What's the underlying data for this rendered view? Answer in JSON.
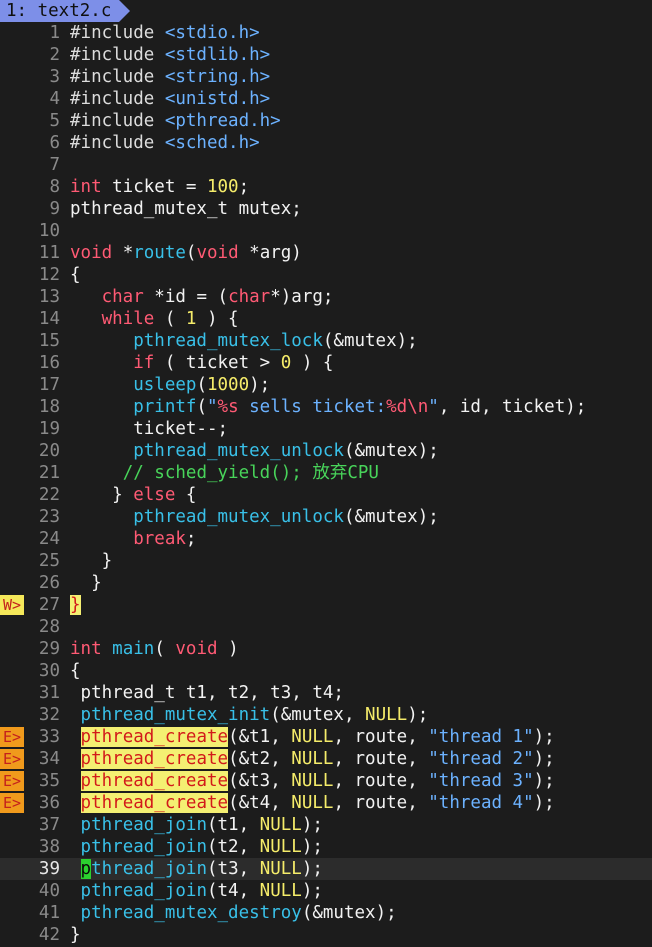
{
  "tab": {
    "label": "1: text2.c"
  },
  "colors": {
    "tab_bg": "#7d8fe8",
    "background": "#1c1c1c",
    "error_sign": "#f09a1c",
    "warning_sign": "#f5e85a",
    "cursor": "#2bd12e"
  },
  "signs": {
    "error": "E>",
    "warning": "W>"
  },
  "cursor": {
    "line": 39
  },
  "lines": [
    {
      "n": "1",
      "t": [
        [
          "#include ",
          "pp"
        ],
        [
          "<stdio.h>",
          "inc"
        ]
      ]
    },
    {
      "n": "2",
      "t": [
        [
          "#include ",
          "pp"
        ],
        [
          "<stdlib.h>",
          "inc"
        ]
      ]
    },
    {
      "n": "3",
      "t": [
        [
          "#include ",
          "pp"
        ],
        [
          "<string.h>",
          "inc"
        ]
      ]
    },
    {
      "n": "4",
      "t": [
        [
          "#include ",
          "pp"
        ],
        [
          "<unistd.h>",
          "inc"
        ]
      ]
    },
    {
      "n": "5",
      "t": [
        [
          "#include ",
          "pp"
        ],
        [
          "<pthread.h>",
          "inc"
        ]
      ]
    },
    {
      "n": "6",
      "t": [
        [
          "#include ",
          "pp"
        ],
        [
          "<sched.h>",
          "inc"
        ]
      ]
    },
    {
      "n": "7",
      "t": []
    },
    {
      "n": "8",
      "t": [
        [
          "int",
          "ty"
        ],
        [
          " ticket = ",
          ""
        ],
        [
          "100",
          "num"
        ],
        [
          ";",
          ""
        ]
      ]
    },
    {
      "n": "9",
      "t": [
        [
          "pthread_mutex_t mutex;",
          ""
        ]
      ]
    },
    {
      "n": "10",
      "t": []
    },
    {
      "n": "11",
      "t": [
        [
          "void",
          "ty"
        ],
        [
          " *",
          ""
        ],
        [
          "route",
          "fn"
        ],
        [
          "(",
          ""
        ],
        [
          "void",
          "ty"
        ],
        [
          " *arg)",
          ""
        ]
      ]
    },
    {
      "n": "12",
      "t": [
        [
          "{",
          ""
        ]
      ]
    },
    {
      "n": "13",
      "t": [
        [
          "   ",
          ""
        ],
        [
          "char",
          "ty"
        ],
        [
          " *id = (",
          ""
        ],
        [
          "char",
          "ty"
        ],
        [
          "*)arg;",
          ""
        ]
      ]
    },
    {
      "n": "14",
      "t": [
        [
          "   ",
          ""
        ],
        [
          "while",
          "kw"
        ],
        [
          " ( ",
          ""
        ],
        [
          "1",
          "num"
        ],
        [
          " ) {",
          ""
        ]
      ]
    },
    {
      "n": "15",
      "t": [
        [
          "      ",
          ""
        ],
        [
          "pthread_mutex_lock",
          "fn"
        ],
        [
          "(&mutex);",
          ""
        ]
      ]
    },
    {
      "n": "16",
      "t": [
        [
          "      ",
          ""
        ],
        [
          "if",
          "kw"
        ],
        [
          " ( ticket > ",
          ""
        ],
        [
          "0",
          "num"
        ],
        [
          " ) {",
          ""
        ]
      ]
    },
    {
      "n": "17",
      "t": [
        [
          "      ",
          ""
        ],
        [
          "usleep",
          "fn"
        ],
        [
          "(",
          ""
        ],
        [
          "1000",
          "num"
        ],
        [
          ");",
          ""
        ]
      ]
    },
    {
      "n": "18",
      "t": [
        [
          "      ",
          ""
        ],
        [
          "printf",
          "fn"
        ],
        [
          "(",
          ""
        ],
        [
          "\"",
          "str"
        ],
        [
          "%s",
          "esc"
        ],
        [
          " sells ticket:",
          "str"
        ],
        [
          "%d\\n",
          "esc"
        ],
        [
          "\"",
          "str"
        ],
        [
          ", id, ticket);",
          ""
        ]
      ]
    },
    {
      "n": "19",
      "t": [
        [
          "      ticket--;",
          ""
        ]
      ]
    },
    {
      "n": "20",
      "t": [
        [
          "      ",
          ""
        ],
        [
          "pthread_mutex_unlock",
          "fn"
        ],
        [
          "(&mutex);",
          ""
        ]
      ]
    },
    {
      "n": "21",
      "t": [
        [
          "     ",
          ""
        ],
        [
          "// sched_yield(); 放弃CPU",
          "cm"
        ]
      ]
    },
    {
      "n": "22",
      "t": [
        [
          "    } ",
          ""
        ],
        [
          "else",
          "kw"
        ],
        [
          " {",
          ""
        ]
      ]
    },
    {
      "n": "23",
      "t": [
        [
          "      ",
          ""
        ],
        [
          "pthread_mutex_unlock",
          "fn"
        ],
        [
          "(&mutex);",
          ""
        ]
      ]
    },
    {
      "n": "24",
      "t": [
        [
          "      ",
          ""
        ],
        [
          "break",
          "kw"
        ],
        [
          ";",
          ""
        ]
      ]
    },
    {
      "n": "25",
      "t": [
        [
          "   }",
          ""
        ]
      ]
    },
    {
      "n": "26",
      "t": [
        [
          "  }",
          ""
        ]
      ]
    },
    {
      "n": "27",
      "sign": "warn",
      "t": [
        [
          "}",
          "warnhl"
        ]
      ]
    },
    {
      "n": "28",
      "t": []
    },
    {
      "n": "29",
      "t": [
        [
          "int",
          "ty"
        ],
        [
          " ",
          ""
        ],
        [
          "main",
          "fn"
        ],
        [
          "( ",
          ""
        ],
        [
          "void",
          "ty"
        ],
        [
          " )",
          ""
        ]
      ]
    },
    {
      "n": "30",
      "t": [
        [
          "{",
          ""
        ]
      ]
    },
    {
      "n": "31",
      "t": [
        [
          " pthread_t t1, t2, t3, t4;",
          ""
        ]
      ]
    },
    {
      "n": "32",
      "t": [
        [
          " ",
          ""
        ],
        [
          "pthread_mutex_init",
          "fn"
        ],
        [
          "(&mutex, ",
          ""
        ],
        [
          "NULL",
          "nul"
        ],
        [
          ");",
          ""
        ]
      ]
    },
    {
      "n": "33",
      "sign": "err",
      "t": [
        [
          " ",
          ""
        ],
        [
          "pthread_create",
          "errhl"
        ],
        [
          "(&t1, ",
          ""
        ],
        [
          "NULL",
          "nul"
        ],
        [
          ", route, ",
          ""
        ],
        [
          "\"thread 1\"",
          "str"
        ],
        [
          ");",
          ""
        ]
      ]
    },
    {
      "n": "34",
      "sign": "err",
      "t": [
        [
          " ",
          ""
        ],
        [
          "pthread_create",
          "errhl"
        ],
        [
          "(&t2, ",
          ""
        ],
        [
          "NULL",
          "nul"
        ],
        [
          ", route, ",
          ""
        ],
        [
          "\"thread 2\"",
          "str"
        ],
        [
          ");",
          ""
        ]
      ]
    },
    {
      "n": "35",
      "sign": "err",
      "t": [
        [
          " ",
          ""
        ],
        [
          "pthread_create",
          "errhl"
        ],
        [
          "(&t3, ",
          ""
        ],
        [
          "NULL",
          "nul"
        ],
        [
          ", route, ",
          ""
        ],
        [
          "\"thread 3\"",
          "str"
        ],
        [
          ");",
          ""
        ]
      ]
    },
    {
      "n": "36",
      "sign": "err",
      "t": [
        [
          " ",
          ""
        ],
        [
          "pthread_create",
          "errhl"
        ],
        [
          "(&t4, ",
          ""
        ],
        [
          "NULL",
          "nul"
        ],
        [
          ", route, ",
          ""
        ],
        [
          "\"thread 4\"",
          "str"
        ],
        [
          ");",
          ""
        ]
      ]
    },
    {
      "n": "37",
      "t": [
        [
          " ",
          ""
        ],
        [
          "pthread_join",
          "fn"
        ],
        [
          "(t1, ",
          ""
        ],
        [
          "NULL",
          "nul"
        ],
        [
          ");",
          ""
        ]
      ]
    },
    {
      "n": "38",
      "t": [
        [
          " ",
          ""
        ],
        [
          "pthread_join",
          "fn"
        ],
        [
          "(t2, ",
          ""
        ],
        [
          "NULL",
          "nul"
        ],
        [
          ");",
          ""
        ]
      ]
    },
    {
      "n": "39",
      "t": [
        [
          " ",
          ""
        ],
        [
          "p",
          "cur"
        ],
        [
          "thread_join",
          "fn"
        ],
        [
          "(t3, ",
          ""
        ],
        [
          "NULL",
          "nul"
        ],
        [
          ");",
          ""
        ]
      ]
    },
    {
      "n": "40",
      "t": [
        [
          " ",
          ""
        ],
        [
          "pthread_join",
          "fn"
        ],
        [
          "(t4, ",
          ""
        ],
        [
          "NULL",
          "nul"
        ],
        [
          ");",
          ""
        ]
      ]
    },
    {
      "n": "41",
      "t": [
        [
          " ",
          ""
        ],
        [
          "pthread_mutex_destroy",
          "fn"
        ],
        [
          "(&mutex);",
          ""
        ]
      ]
    },
    {
      "n": "42",
      "t": [
        [
          "}",
          ""
        ]
      ]
    }
  ]
}
